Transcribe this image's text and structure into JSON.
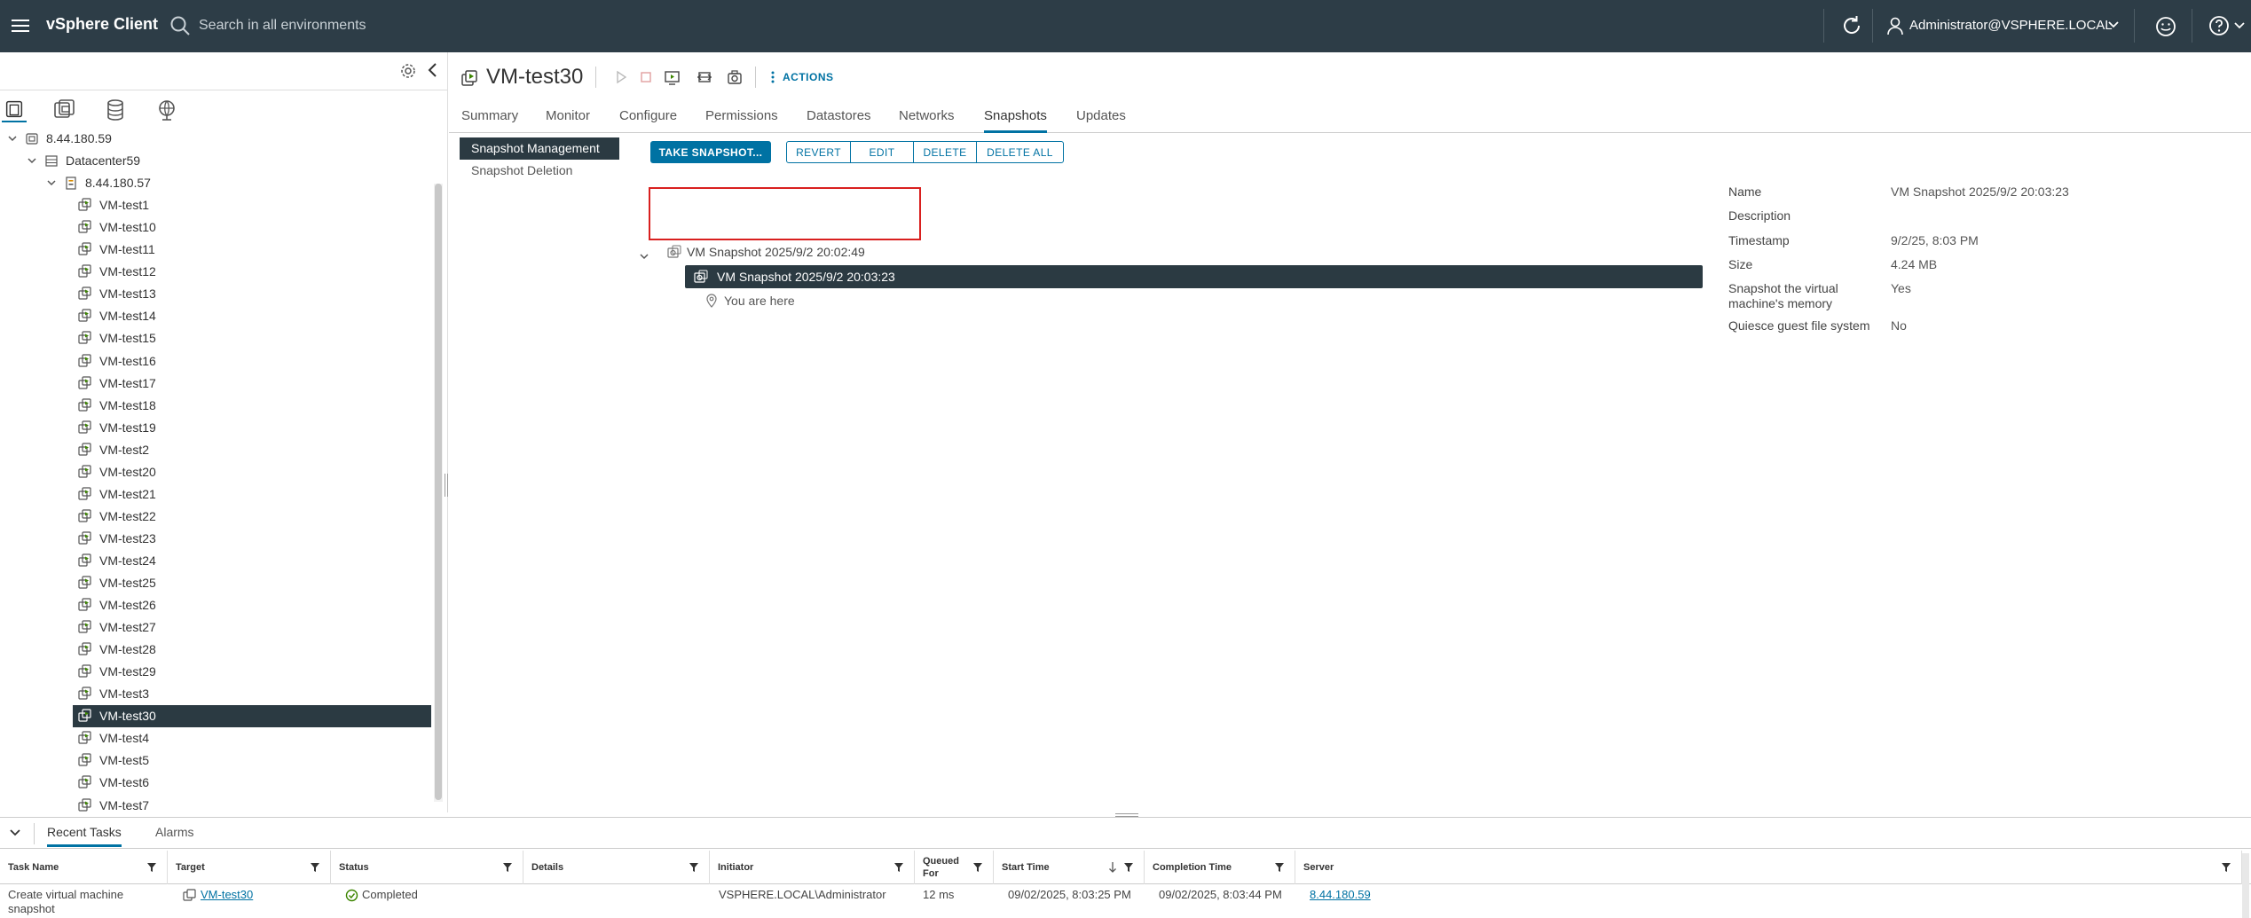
{
  "header": {
    "app_title": "vSphere Client",
    "search_placeholder": "Search in all environments",
    "user": "Administrator@VSPHERE.LOCAL"
  },
  "navigator": {
    "tree": [
      {
        "label": "8.44.180.59",
        "type": "vcenter",
        "level": 0
      },
      {
        "label": "Datacenter59",
        "type": "datacenter",
        "level": 1
      },
      {
        "label": "8.44.180.57",
        "type": "host",
        "level": 2
      },
      {
        "label": "VM-test1",
        "type": "vm",
        "level": 3
      },
      {
        "label": "VM-test10",
        "type": "vm",
        "level": 3
      },
      {
        "label": "VM-test11",
        "type": "vm",
        "level": 3
      },
      {
        "label": "VM-test12",
        "type": "vm",
        "level": 3
      },
      {
        "label": "VM-test13",
        "type": "vm",
        "level": 3
      },
      {
        "label": "VM-test14",
        "type": "vm",
        "level": 3
      },
      {
        "label": "VM-test15",
        "type": "vm",
        "level": 3
      },
      {
        "label": "VM-test16",
        "type": "vm",
        "level": 3
      },
      {
        "label": "VM-test17",
        "type": "vm",
        "level": 3
      },
      {
        "label": "VM-test18",
        "type": "vm",
        "level": 3
      },
      {
        "label": "VM-test19",
        "type": "vm",
        "level": 3
      },
      {
        "label": "VM-test2",
        "type": "vm",
        "level": 3
      },
      {
        "label": "VM-test20",
        "type": "vm",
        "level": 3
      },
      {
        "label": "VM-test21",
        "type": "vm",
        "level": 3
      },
      {
        "label": "VM-test22",
        "type": "vm",
        "level": 3
      },
      {
        "label": "VM-test23",
        "type": "vm",
        "level": 3
      },
      {
        "label": "VM-test24",
        "type": "vm",
        "level": 3
      },
      {
        "label": "VM-test25",
        "type": "vm",
        "level": 3
      },
      {
        "label": "VM-test26",
        "type": "vm",
        "level": 3
      },
      {
        "label": "VM-test27",
        "type": "vm",
        "level": 3
      },
      {
        "label": "VM-test28",
        "type": "vm",
        "level": 3
      },
      {
        "label": "VM-test29",
        "type": "vm",
        "level": 3
      },
      {
        "label": "VM-test3",
        "type": "vm",
        "level": 3
      },
      {
        "label": "VM-test30",
        "type": "vm",
        "level": 3,
        "selected": true
      },
      {
        "label": "VM-test4",
        "type": "vm",
        "level": 3
      },
      {
        "label": "VM-test5",
        "type": "vm",
        "level": 3
      },
      {
        "label": "VM-test6",
        "type": "vm",
        "level": 3
      },
      {
        "label": "VM-test7",
        "type": "vm",
        "level": 3
      }
    ]
  },
  "object": {
    "title": "VM-test30",
    "actions_label": "ACTIONS"
  },
  "tabs": [
    "Summary",
    "Monitor",
    "Configure",
    "Permissions",
    "Datastores",
    "Networks",
    "Snapshots",
    "Updates"
  ],
  "active_tab": "Snapshots",
  "subnav": [
    "Snapshot Management",
    "Snapshot Deletion"
  ],
  "buttons": {
    "take_snapshot": "TAKE SNAPSHOT...",
    "revert": "REVERT",
    "edit": "EDIT",
    "delete": "DELETE",
    "delete_all": "DELETE ALL"
  },
  "snapshot_tree": {
    "parent": "VM Snapshot 2025/9/2 20:02:49",
    "child": "VM Snapshot 2025/9/2 20:03:23",
    "you_are_here": "You are here"
  },
  "details": [
    {
      "key": "Name",
      "value": "VM Snapshot 2025/9/2 20:03:23"
    },
    {
      "key": "Description",
      "value": ""
    },
    {
      "key": "Timestamp",
      "value": "9/2/25, 8:03 PM"
    },
    {
      "key": "Size",
      "value": "4.24 MB"
    },
    {
      "key": "Snapshot the virtual machine's memory",
      "value": "Yes"
    },
    {
      "key": "Quiesce guest file system",
      "value": "No"
    }
  ],
  "tasks_panel": {
    "tabs": [
      "Recent Tasks",
      "Alarms"
    ],
    "columns": [
      "Task Name",
      "Target",
      "Status",
      "Details",
      "Initiator",
      "Queued For",
      "Start Time",
      "Completion Time",
      "Server"
    ],
    "rows": [
      {
        "task_name": "Create virtual machine snapshot",
        "target": "VM-test30",
        "status": "Completed",
        "details": "",
        "initiator": "VSPHERE.LOCAL\\Administrator",
        "queued_for": "12 ms",
        "start_time": "09/02/2025, 8:03:25 PM",
        "completion_time": "09/02/2025, 8:03:44 PM",
        "server": "8.44.180.59"
      }
    ]
  },
  "colors": {
    "header_bg": "#2d3d47",
    "accent": "#0072a3",
    "selection_bg": "#2b3a42",
    "highlight_border": "#d9201f",
    "success": "#3c8500"
  }
}
